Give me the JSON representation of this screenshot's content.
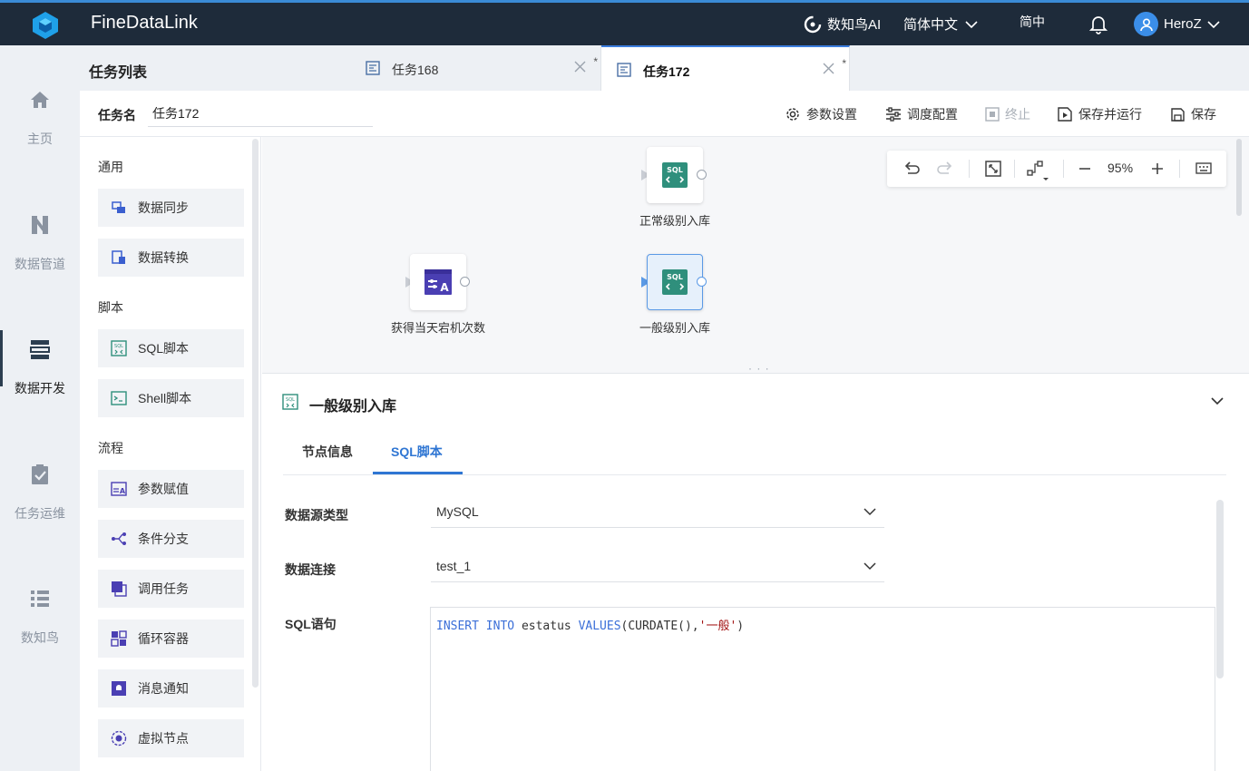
{
  "app": {
    "title": "FineDataLink"
  },
  "topbar": {
    "ai_label": "数知鸟AI",
    "language": "简体中文",
    "simplified": "简中",
    "username": "HeroZ"
  },
  "leftnav": {
    "items": [
      {
        "label": "主页",
        "icon": "home-icon"
      },
      {
        "label": "数据管道",
        "icon": "pipeline-icon"
      },
      {
        "label": "数据开发",
        "icon": "dev-icon",
        "active": true
      },
      {
        "label": "任务运维",
        "icon": "clipboard-check-icon"
      },
      {
        "label": "数知鸟",
        "icon": "list-icon"
      }
    ]
  },
  "tasklist": {
    "title": "任务列表"
  },
  "tabs": [
    {
      "label": "任务168",
      "modified": "*"
    },
    {
      "label": "任务172",
      "modified": "*",
      "active": true
    }
  ],
  "task": {
    "name_label": "任务名",
    "name_value": "任务172"
  },
  "toolbar": {
    "params": "参数设置",
    "schedule": "调度配置",
    "stop": "终止",
    "save_run": "保存并运行",
    "save": "保存"
  },
  "palette": {
    "groups": [
      {
        "label": "通用",
        "items": [
          {
            "label": "数据同步"
          },
          {
            "label": "数据转换"
          }
        ]
      },
      {
        "label": "脚本",
        "items": [
          {
            "label": "SQL脚本"
          },
          {
            "label": "Shell脚本"
          }
        ]
      },
      {
        "label": "流程",
        "items": [
          {
            "label": "参数赋值"
          },
          {
            "label": "条件分支"
          },
          {
            "label": "调用任务"
          },
          {
            "label": "循环容器"
          },
          {
            "label": "消息通知"
          },
          {
            "label": "虚拟节点"
          }
        ]
      }
    ]
  },
  "canvas": {
    "zoom": "95%",
    "nodes": [
      {
        "label": "正常级别入库",
        "icon_text": "SQL"
      },
      {
        "label": "获得当天宕机次数",
        "icon_text": "EA"
      },
      {
        "label": "一般级别入库",
        "icon_text": "SQL",
        "selected": true
      }
    ]
  },
  "detail": {
    "title": "一般级别入库",
    "tabs": [
      "节点信息",
      "SQL脚本"
    ],
    "active_tab": "SQL脚本",
    "fields": {
      "datasource_type_label": "数据源类型",
      "datasource_type_value": "MySQL",
      "connection_label": "数据连接",
      "connection_value": "test_1",
      "sql_label": "SQL语句"
    },
    "sql": {
      "kw1": "INSERT",
      "kw2": "INTO",
      "table": "estatus",
      "kw3": "VALUES",
      "call": "(CURDATE(),",
      "str": "'一般'",
      "close": ")"
    }
  },
  "colors": {
    "topbar": "#1e2b3a",
    "accent": "#2f76d3",
    "node_icon": "#2f8f7c",
    "node_icon_purple": "#4a3fb3"
  }
}
